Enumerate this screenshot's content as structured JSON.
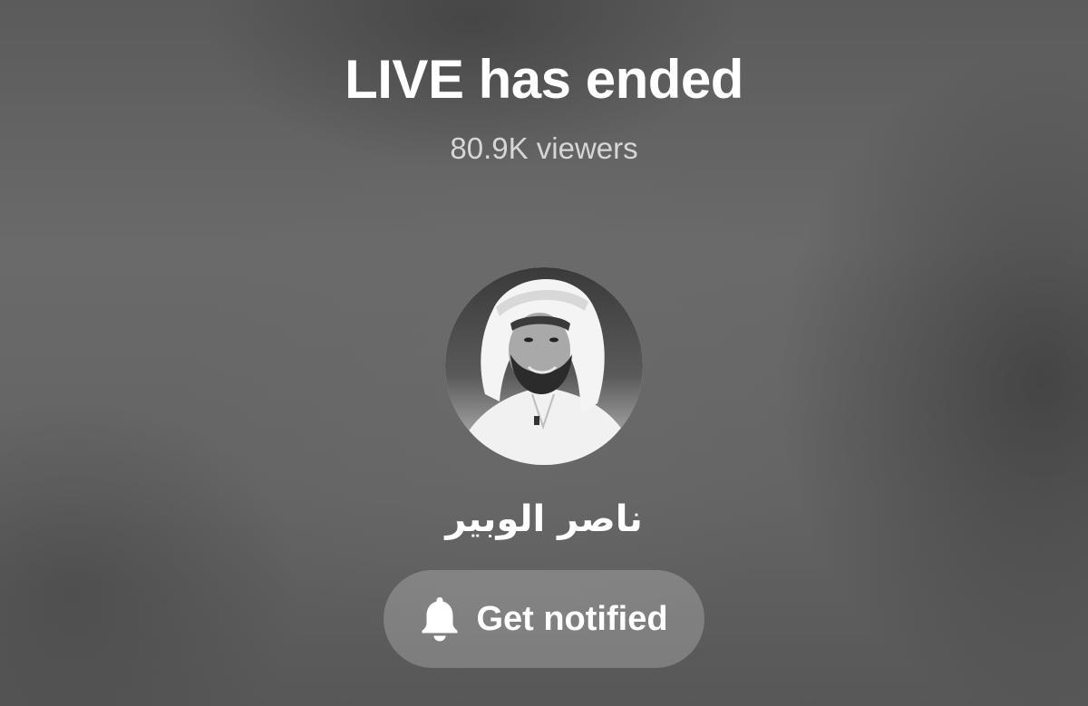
{
  "live_status": {
    "title": "LIVE has ended",
    "viewers": "80.9K viewers"
  },
  "host": {
    "name": "ناصر الوبير",
    "avatar_icon": "profile-photo"
  },
  "actions": {
    "notify_label": "Get notified",
    "notify_icon": "bell-icon"
  }
}
